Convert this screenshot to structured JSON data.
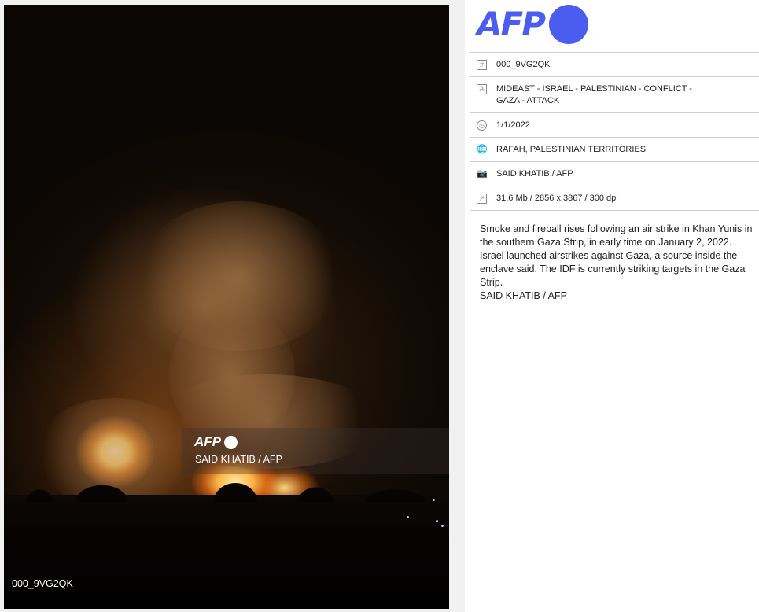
{
  "photo": {
    "watermark": {
      "logo_text": "AFP",
      "credit": "SAID KHATIB / AFP"
    },
    "id_overlay": "000_9VG2QK"
  },
  "info": {
    "logo_text": "AFP",
    "brand_color": "#4b5cf0",
    "meta": [
      {
        "icon": "hash-icon",
        "text": "000_9VG2QK"
      },
      {
        "icon": "title-icon",
        "text": "MIDEAST - ISRAEL - PALESTINIAN - CONFLICT - GAZA - ATTACK"
      },
      {
        "icon": "clock-icon",
        "text": "1/1/2022"
      },
      {
        "icon": "globe-icon",
        "text": "RAFAH, PALESTINIAN TERRITORIES"
      },
      {
        "icon": "camera-icon",
        "text": "SAID KHATIB / AFP"
      },
      {
        "icon": "resize-icon",
        "text": "31.6 Mb / 2856 x 3867 / 300 dpi"
      }
    ],
    "caption": "Smoke and fireball rises following an air strike in Khan Yunis in the southern Gaza Strip, in early time on January 2, 2022. Israel launched airstrikes against Gaza, a source inside the enclave said. The IDF is currently striking targets in the Gaza Strip.",
    "caption_credit": "SAID KHATIB / AFP"
  }
}
